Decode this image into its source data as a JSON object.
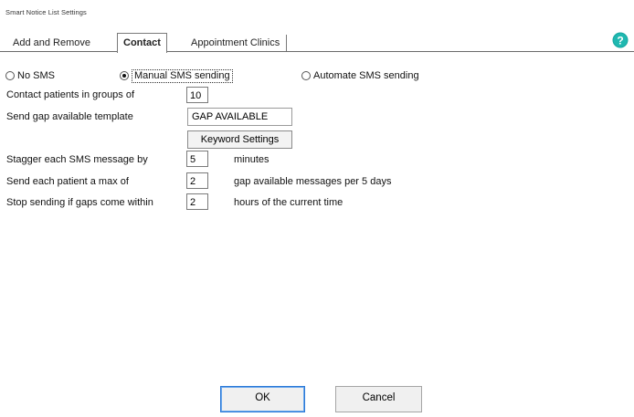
{
  "window": {
    "title": "Smart Notice List Settings"
  },
  "tabs": [
    {
      "label": "Add and Remove"
    },
    {
      "label": "Contact",
      "active": true
    },
    {
      "label": "Appointment Clinics"
    }
  ],
  "help_icon": "help-icon",
  "sms_mode": {
    "options": [
      {
        "label": "No SMS",
        "selected": false
      },
      {
        "label": "Manual SMS sending",
        "selected": true
      },
      {
        "label": "Automate SMS sending",
        "selected": false
      }
    ]
  },
  "settings": {
    "groups_label": "Contact patients in groups of",
    "groups_value": "10",
    "template_label": "Send gap available template",
    "template_value": "GAP AVAILABLE",
    "keyword_button": "Keyword Settings",
    "stagger_label": "Stagger each SMS message by",
    "stagger_value": "5",
    "stagger_unit": "minutes",
    "max_label": "Send each patient a max of",
    "max_value": "2",
    "max_unit": "gap available messages per 5 days",
    "stop_label": "Stop sending if gaps come within",
    "stop_value": "2",
    "stop_unit": "hours of the current time"
  },
  "footer": {
    "ok_label": "OK",
    "cancel_label": "Cancel"
  }
}
